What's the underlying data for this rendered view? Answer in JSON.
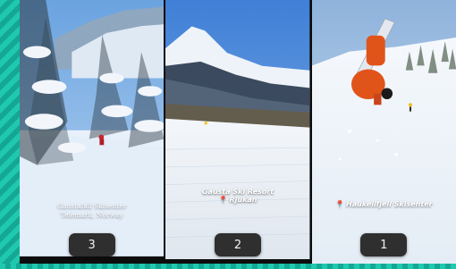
{
  "panels": [
    {
      "location_line1": "Gaustafall Skisenter",
      "location_line2": "Telemark, Norway",
      "number": "3"
    },
    {
      "location_line1": "Gausta Ski Resort",
      "location_line2": "Rjukan",
      "number": "2"
    },
    {
      "location_line1": "Haukelifjell Skisenter",
      "number": "1"
    }
  ],
  "icons": [
    "map-pin-icon"
  ],
  "colors": {
    "accent_stripe": "#1fc9b0",
    "badge_bg": "#2f2f2f",
    "pin": "#e23b3b"
  }
}
